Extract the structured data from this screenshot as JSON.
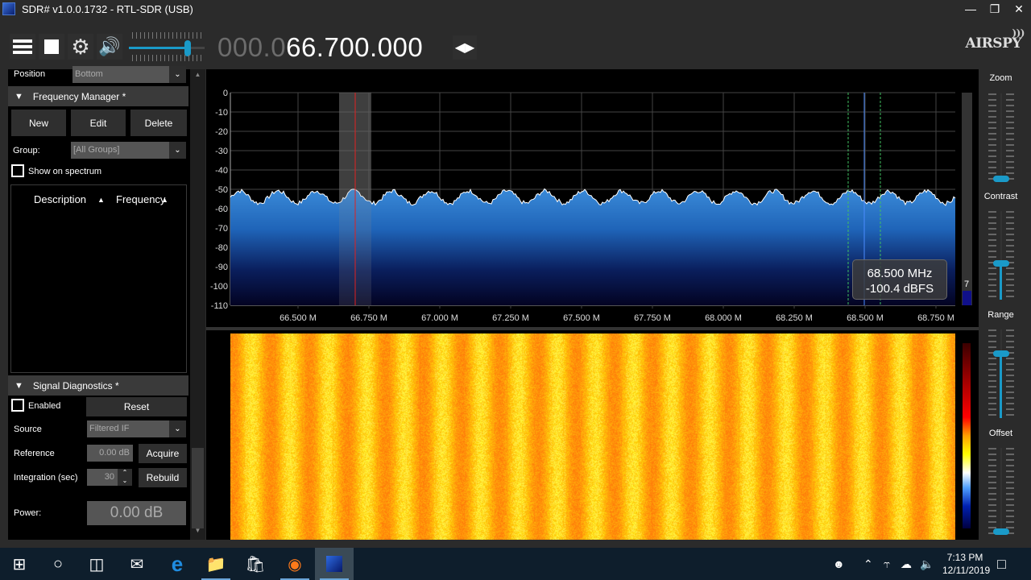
{
  "window": {
    "title": "SDR# v1.0.0.1732 - RTL-SDR (USB)",
    "controls": [
      "minimize",
      "restore",
      "close"
    ]
  },
  "toolbar": {
    "frequency_dim": "000.0",
    "frequency_lit": "66.700.000",
    "volume_fraction": 0.78,
    "logo": "AIRSPY"
  },
  "left_panel": {
    "position_label": "Position",
    "position_value": "Bottom",
    "freq_manager": {
      "title": "Frequency Manager *",
      "new_label": "New",
      "edit_label": "Edit",
      "delete_label": "Delete",
      "group_label": "Group:",
      "group_value": "[All Groups]",
      "show_on_spectrum_label": "Show on spectrum",
      "show_on_spectrum_checked": false,
      "columns": [
        "Description",
        "Frequency"
      ]
    },
    "signal_diagnostics": {
      "title": "Signal Diagnostics *",
      "enabled_label": "Enabled",
      "enabled_checked": false,
      "reset_label": "Reset",
      "source_label": "Source",
      "source_value": "Filtered IF",
      "reference_label": "Reference",
      "reference_value": "0.00 dB",
      "acquire_label": "Acquire",
      "integration_label": "Integration (sec)",
      "integration_value": "30",
      "rebuild_label": "Rebuild",
      "power_label": "Power:",
      "power_value": "0.00 dB"
    }
  },
  "spectrum": {
    "y_ticks": [
      "0",
      "-10",
      "-20",
      "-30",
      "-40",
      "-50",
      "-60",
      "-70",
      "-80",
      "-90",
      "-100",
      "-110"
    ],
    "x_ticks": [
      "66.500 M",
      "66.750 M",
      "67.000 M",
      "67.250 M",
      "67.500 M",
      "67.750 M",
      "68.000 M",
      "68.250 M",
      "68.500 M",
      "68.750 M"
    ],
    "tooltip_freq": "68.500 MHz",
    "tooltip_level": "-100.4 dBFS",
    "side_value": "7",
    "colors": {
      "trace": "#ffffff",
      "fill_top": "#2f7fd0",
      "tuned_line": "#e02020",
      "cursor_line": "#4a8cff",
      "filter_edges": "#40c060"
    }
  },
  "right_panel": {
    "zoom_label": "Zoom",
    "contrast_label": "Contrast",
    "range_label": "Range",
    "offset_label": "Offset",
    "zoom_fraction": 0.0,
    "contrast_fraction": 0.4,
    "range_fraction": 0.75,
    "offset_fraction": 0.0
  },
  "taskbar": {
    "icons": [
      "windows-start-icon",
      "cortana-search-icon",
      "task-view-icon",
      "mail-icon",
      "edge-icon",
      "file-explorer-icon",
      "store-icon",
      "firefox-icon",
      "sdrsharp-icon"
    ],
    "time": "7:13 PM",
    "date": "12/11/2019"
  }
}
